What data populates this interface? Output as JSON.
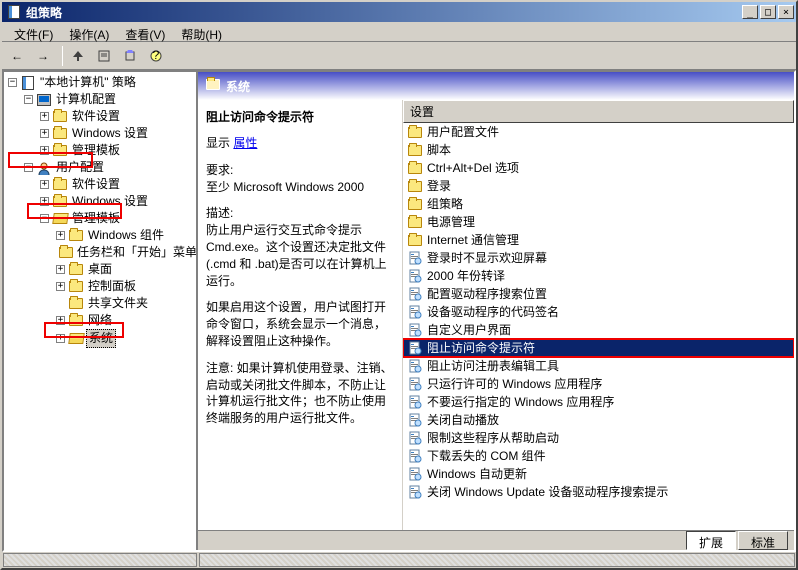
{
  "window": {
    "title": "组策略"
  },
  "menus": {
    "file": "文件(F)",
    "action": "操作(A)",
    "view": "查看(V)",
    "help": "帮助(H)"
  },
  "tree": {
    "root": "\"本地计算机\" 策略",
    "computer_config": "计算机配置",
    "software_settings": "软件设置",
    "windows_settings": "Windows 设置",
    "admin_templates": "管理模板",
    "user_config": "用户配置",
    "windows_components": "Windows 组件",
    "taskbar_startmenu": "任务栏和「开始」菜单",
    "desktop": "桌面",
    "control_panel": "控制面板",
    "shared_folders": "共享文件夹",
    "network": "网络",
    "system": "系统"
  },
  "header": {
    "title": "系统"
  },
  "description": {
    "title": "阻止访问命令提示符",
    "show_label": "显示",
    "properties_link": "属性",
    "req_label": "要求:",
    "req_value": "至少 Microsoft Windows 2000",
    "desc_label": "描述:",
    "desc_p1": "防止用户运行交互式命令提示 Cmd.exe。这个设置还决定批文件 (.cmd 和 .bat)是否可以在计算机上运行。",
    "desc_p2": "如果启用这个设置，用户试图打开命令窗口，系统会显示一个消息，解释设置阻止这种操作。",
    "desc_p3": "注意: 如果计算机使用登录、注销、启动或关闭批文件脚本，不防止让计算机运行批文件；也不防止使用终端服务的用户运行批文件。"
  },
  "list_header": "设置",
  "list": [
    "用户配置文件",
    "脚本",
    "Ctrl+Alt+Del 选项",
    "登录",
    "组策略",
    "电源管理",
    "Internet 通信管理",
    "登录时不显示欢迎屏幕",
    "2000 年份转译",
    "配置驱动程序搜索位置",
    "设备驱动程序的代码签名",
    "自定义用户界面",
    "阻止访问命令提示符",
    "阻止访问注册表编辑工具",
    "只运行许可的 Windows 应用程序",
    "不要运行指定的 Windows 应用程序",
    "关闭自动播放",
    "限制这些程序从帮助启动",
    "下载丢失的 COM 组件",
    "Windows 自动更新",
    "关闭 Windows Update 设备驱动程序搜索提示"
  ],
  "selected_list_index": 12,
  "tabs": {
    "extended": "扩展",
    "standard": "标准"
  }
}
